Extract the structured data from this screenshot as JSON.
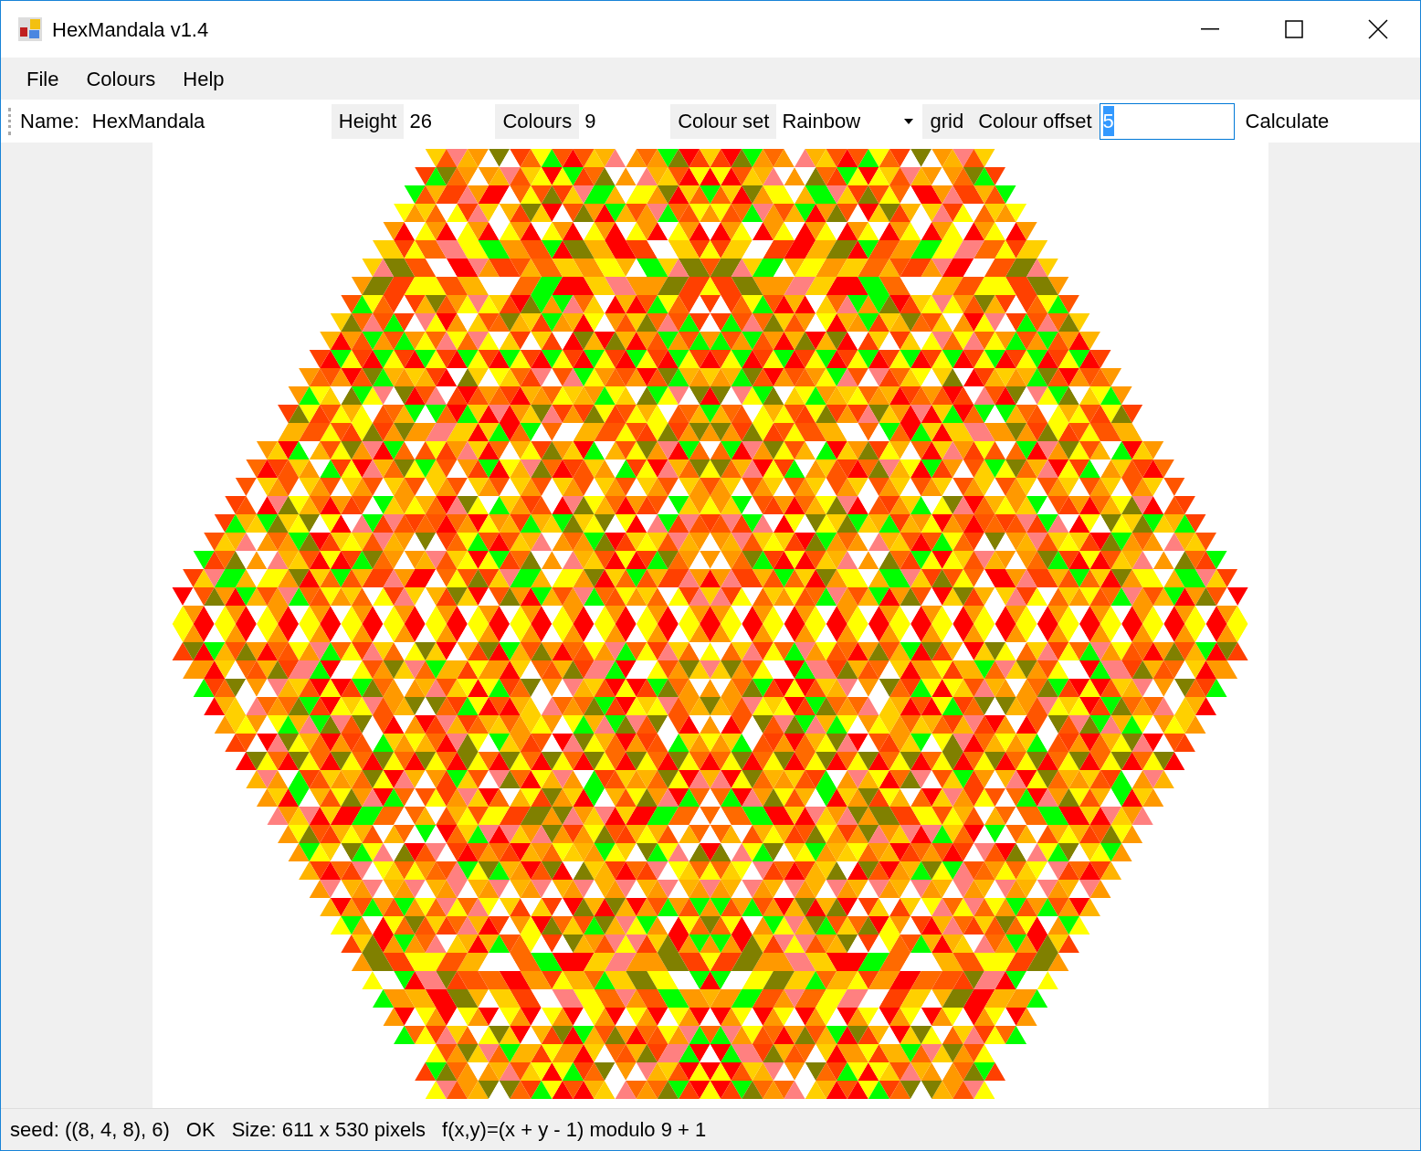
{
  "window": {
    "title": "HexMandala v1.4"
  },
  "menu": [
    "File",
    "Colours",
    "Help"
  ],
  "toolbar": {
    "name_label": "Name:",
    "name_value": "HexMandala",
    "height_label": "Height",
    "height_value": "26",
    "colours_label": "Colours",
    "colours_value": "9",
    "colour_set_label": "Colour set",
    "colour_set_value": "Rainbow",
    "grid_label": "grid",
    "colour_offset_label": "Colour offset",
    "colour_offset_value": "5",
    "calculate": "Calculate"
  },
  "status_bar": [
    "seed: ((8, 4, 8), 6)",
    "OK",
    "Size: 611 x 530 pixels",
    "f(x,y)=(x + y - 1) modulo 9 + 1"
  ]
}
